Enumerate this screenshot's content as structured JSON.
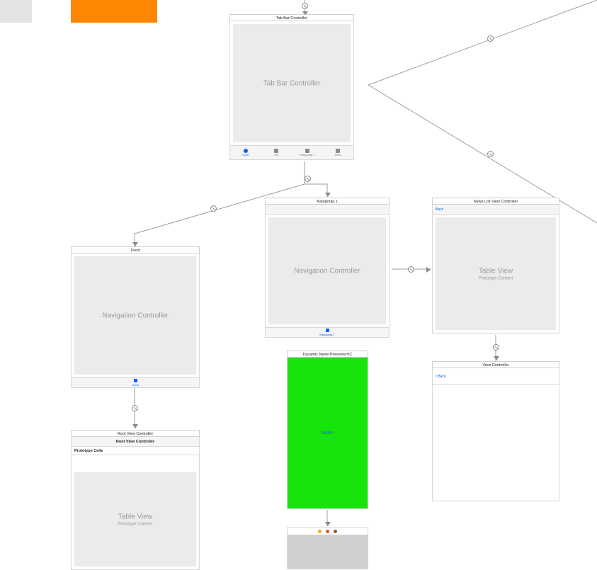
{
  "top_swatches": {
    "gray": "#e3e3e3",
    "orange": "#ff8600"
  },
  "tabbar_scene": {
    "title": "Tab Bar Controller",
    "body_label": "Tab Bar Controller",
    "tabs": [
      {
        "label": "Uvod",
        "active": true,
        "shape": "circle"
      },
      {
        "label": "Tim",
        "active": false,
        "shape": "square"
      },
      {
        "label": "Kategorija 1",
        "active": false,
        "shape": "square"
      },
      {
        "label": "Izbor",
        "active": false,
        "shape": "square"
      }
    ]
  },
  "nav_left": {
    "title": "Uvod",
    "body_label": "Navigation Controller",
    "bottom_label": "Uvod"
  },
  "nav_mid": {
    "title": "Kategorija 1",
    "body_label": "Navigation Controller",
    "bottom_label": "Kategorija 1"
  },
  "news_list": {
    "title": "News List View Controller",
    "back": "Back",
    "table_label": "Table View",
    "table_sub": "Prototype Content"
  },
  "root_vc": {
    "title": "Root View Controller",
    "nav_title": "Root View Controller",
    "proto_label": "Prototype Cells",
    "table_label": "Table View",
    "table_sub": "Prototype Content"
  },
  "dynamic_news": {
    "title": "Dynamic News PresenterVC",
    "button": "Button"
  },
  "view_controller": {
    "title": "View Controller",
    "back": "Back"
  }
}
